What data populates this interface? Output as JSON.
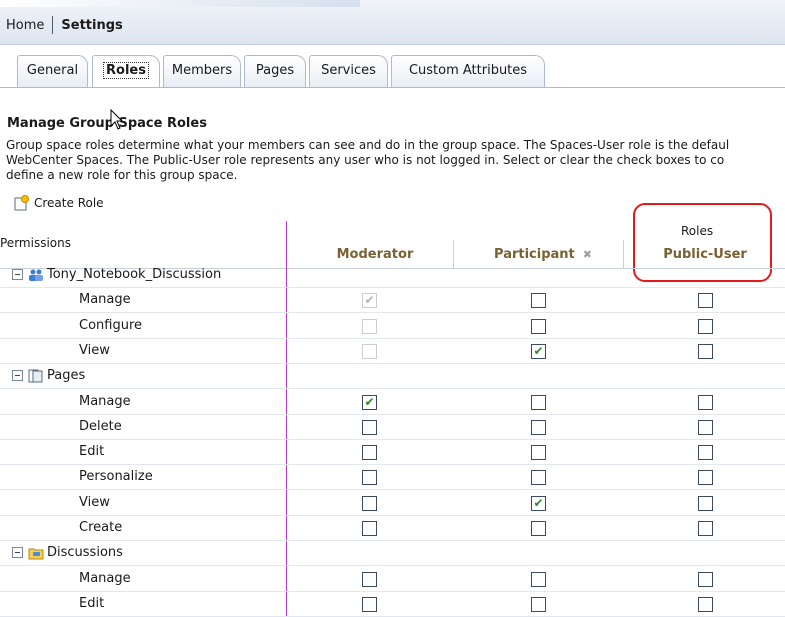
{
  "breadcrumb": {
    "home": "Home",
    "current": "Settings"
  },
  "tabs": [
    {
      "label": "General",
      "active": false
    },
    {
      "label": "Roles",
      "active": true
    },
    {
      "label": "Members",
      "active": false
    },
    {
      "label": "Pages",
      "active": false
    },
    {
      "label": "Services",
      "active": false
    },
    {
      "label": "Custom Attributes",
      "active": false
    }
  ],
  "section": {
    "title": "Manage Group Space Roles",
    "description": [
      "Group space roles determine what your members can see and do in the group space. The Spaces-User role is the defaul",
      "WebCenter Spaces. The Public-User role represents any user who is not logged in. Select or clear the check boxes to co",
      "define a new role for this group space."
    ]
  },
  "toolbar": {
    "create_role": "Create Role"
  },
  "table": {
    "permissions_header": "Permissions",
    "roles_header": "Roles",
    "columns": [
      "Moderator",
      "Participant",
      "Public-User"
    ],
    "groups": [
      {
        "name": "Tony_Notebook_Discussion",
        "icon": "group-space-icon",
        "rows": [
          {
            "label": "Manage",
            "values": [
              "checked-disabled",
              "unchecked",
              "unchecked"
            ]
          },
          {
            "label": "Configure",
            "values": [
              "unchecked-disabled",
              "unchecked",
              "unchecked"
            ]
          },
          {
            "label": "View",
            "values": [
              "unchecked-disabled",
              "checked",
              "unchecked"
            ]
          }
        ]
      },
      {
        "name": "Pages",
        "icon": "pages-icon",
        "rows": [
          {
            "label": "Manage",
            "values": [
              "checked",
              "unchecked",
              "unchecked"
            ]
          },
          {
            "label": "Delete",
            "values": [
              "unchecked",
              "unchecked",
              "unchecked"
            ]
          },
          {
            "label": "Edit",
            "values": [
              "unchecked",
              "unchecked",
              "unchecked"
            ]
          },
          {
            "label": "Personalize",
            "values": [
              "unchecked",
              "unchecked",
              "unchecked"
            ]
          },
          {
            "label": "View",
            "values": [
              "unchecked",
              "checked",
              "unchecked"
            ]
          },
          {
            "label": "Create",
            "values": [
              "unchecked",
              "unchecked",
              "unchecked"
            ]
          }
        ]
      },
      {
        "name": "Discussions",
        "icon": "discussions-folder-icon",
        "rows": [
          {
            "label": "Manage",
            "values": [
              "unchecked",
              "unchecked",
              "unchecked"
            ]
          },
          {
            "label": "Edit",
            "values": [
              "unchecked",
              "unchecked",
              "unchecked"
            ]
          }
        ]
      }
    ]
  },
  "colors": {
    "highlight": "#e31b1b",
    "divider": "#b63ad0",
    "column_header": "#7a6132",
    "check": "#2e8a2e"
  }
}
